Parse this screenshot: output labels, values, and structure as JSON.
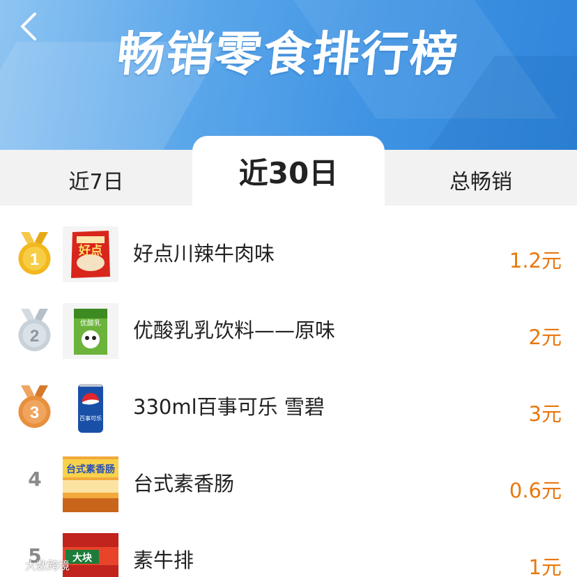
{
  "header": {
    "title": "畅销零食排行榜",
    "back_icon": "chevron-left-icon"
  },
  "tabs": [
    {
      "label": "近7日",
      "active": false
    },
    {
      "label": "近30日",
      "active": true
    },
    {
      "label": "总畅销",
      "active": false
    }
  ],
  "products": [
    {
      "rank": "1",
      "badge": "gold-medal-icon",
      "name": "好点川辣牛肉味",
      "price": "1.2元"
    },
    {
      "rank": "2",
      "badge": "silver-medal-icon",
      "name": "优酸乳乳饮料——原味",
      "price": "2元"
    },
    {
      "rank": "3",
      "badge": "bronze-medal-icon",
      "name": "330ml百事可乐 雪碧",
      "price": "3元"
    },
    {
      "rank": "4",
      "badge": "",
      "name": "台式素香肠",
      "price": "0.6元"
    },
    {
      "rank": "5",
      "badge": "",
      "name": "素牛排",
      "price": "1元"
    }
  ],
  "product_images": {
    "p1_text": "好点",
    "p2_text": "优酸乳",
    "p3_text": "百事可乐",
    "p4_text": "台式素香肠",
    "p5_text": "大块"
  },
  "colors": {
    "accent": "#e8780e",
    "banner_start": "#8ec4f2",
    "banner_end": "#2f86db",
    "gold": "#f2b81e",
    "silver": "#c9d1d8",
    "bronze": "#e8903d"
  },
  "watermark": "大数跨境"
}
